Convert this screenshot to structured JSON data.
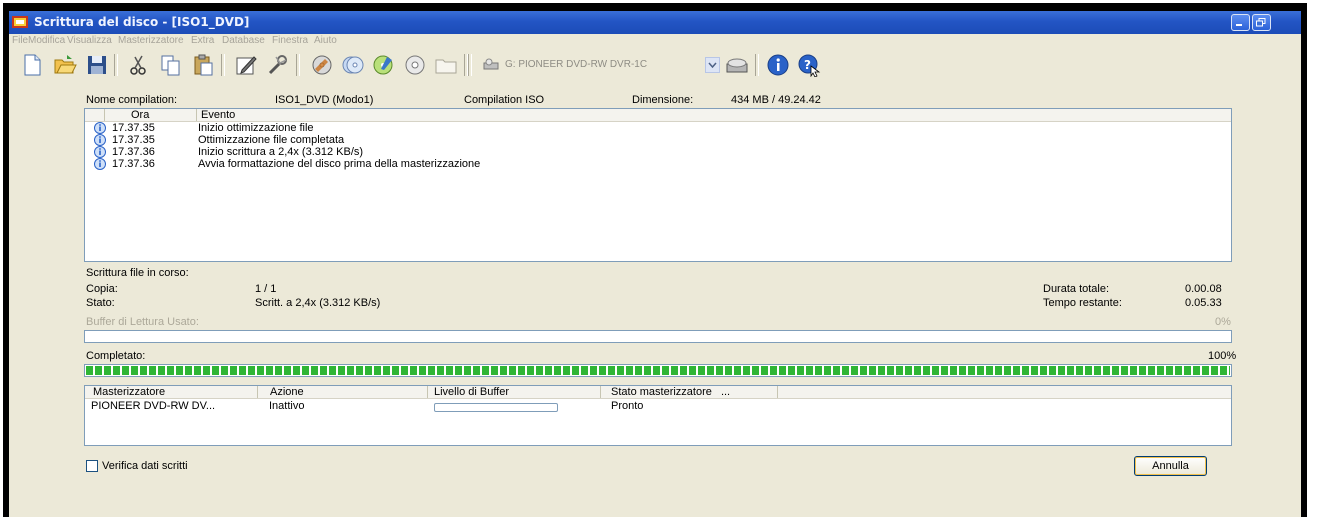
{
  "window": {
    "title": "Scrittura del disco - [ISO1_DVD]"
  },
  "menu": [
    "File",
    "Modifica",
    "Visualizza",
    "Masterizzatore",
    "Extra",
    "Database",
    "Finestra",
    "Aiuto"
  ],
  "toolbar": {
    "drive_label": "G: PIONEER  DVD-RW  DVR-1C"
  },
  "compilation": {
    "name_label": "Nome compilation:",
    "name_value": "ISO1_DVD (Modo1)",
    "type": "Compilation ISO",
    "size_label": "Dimensione:",
    "size_value": "434 MB  /  49.24.42"
  },
  "log": {
    "col_time": "Ora",
    "col_event": "Evento",
    "rows": [
      {
        "time": "17.37.35",
        "event": "Inizio ottimizzazione file",
        "icon": "info-icon"
      },
      {
        "time": "17.37.35",
        "event": "Ottimizzazione file completata",
        "icon": "info-icon"
      },
      {
        "time": "17.37.36",
        "event": "Inizio scrittura a 2,4x (3.312 KB/s)",
        "icon": "info-icon"
      },
      {
        "time": "17.37.36",
        "event": "Avvia formattazione del disco prima della masterizzazione",
        "icon": "info-icon"
      }
    ]
  },
  "status": {
    "writing_label": "Scrittura file in corso:",
    "copy_label": "Copia:",
    "copy_value": "1 / 1",
    "state_label": "Stato:",
    "state_value": "Scritt. a 2,4x (3.312 KB/s)",
    "total_label": "Durata totale:",
    "total_value": "0.00.08",
    "remaining_label": "Tempo restante:",
    "remaining_value": "0.05.33"
  },
  "buffer": {
    "label": "Buffer di Lettura Usato:",
    "percent_text": "0%",
    "fraction": 0.0
  },
  "completed": {
    "label": "Completato:",
    "percent_text": "100%",
    "fraction": 1.0
  },
  "recorders": {
    "col_recorder": "Masterizzatore",
    "col_action": "Azione",
    "col_buffer": "Livello di Buffer",
    "col_state": "Stato masterizzatore",
    "col_more": "...",
    "rows": [
      {
        "recorder": "PIONEER DVD-RW  DV...",
        "action": "Inattivo",
        "buffer_fraction": 0.0,
        "state": "Pronto"
      }
    ]
  },
  "verify_label": "Verifica dati scritti",
  "verify_checked": false,
  "cancel_label": "Annulla",
  "colors": {
    "titlebar": "#2355c4",
    "dialog": "#ece9d8",
    "progress": "#2fb535"
  }
}
